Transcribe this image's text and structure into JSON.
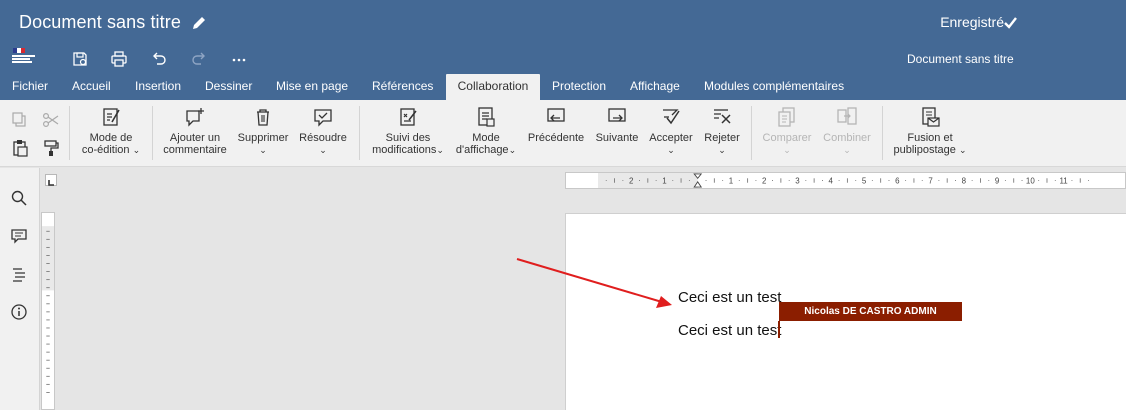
{
  "titlebar": {
    "title": "Document sans titre",
    "status": "Enregistré"
  },
  "quickbar": {
    "doc_title": "Document sans titre"
  },
  "menu": {
    "tabs": [
      "Fichier",
      "Accueil",
      "Insertion",
      "Dessiner",
      "Mise en page",
      "Références",
      "Collaboration",
      "Protection",
      "Affichage",
      "Modules complémentaires"
    ],
    "active": "Collaboration"
  },
  "ribbon": {
    "coedit": [
      "Mode de",
      "co-édition"
    ],
    "add_comment": [
      "Ajouter un",
      "commentaire"
    ],
    "delete": "Supprimer",
    "resolve": "Résoudre",
    "track": [
      "Suivi des",
      "modifications"
    ],
    "display_mode": [
      "Mode",
      "d'affichage"
    ],
    "previous": "Précédente",
    "next": "Suivante",
    "accept": "Accepter",
    "reject": "Rejeter",
    "compare": "Comparer",
    "combine": "Combiner",
    "mailmerge": [
      "Fusion et",
      "publipostage"
    ]
  },
  "document": {
    "lines": [
      "Ceci est un test",
      "Ceci est un test"
    ],
    "collaborator": "Nicolas DE CASTRO ADMIN"
  },
  "ruler": {
    "labels": [
      "2",
      "1",
      "1",
      "2",
      "3",
      "4",
      "5",
      "6",
      "7",
      "8",
      "9",
      "10",
      "11"
    ]
  },
  "colors": {
    "header": "#446995",
    "collaborator": "#8b1e00",
    "arrow": "#e01e1e"
  }
}
